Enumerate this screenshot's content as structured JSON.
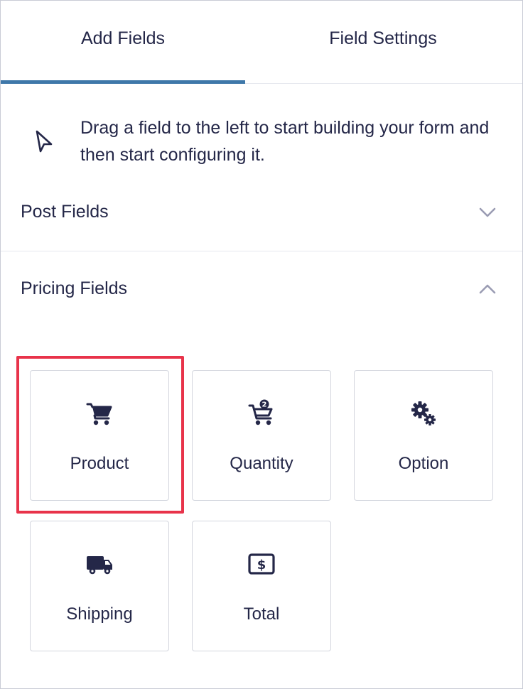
{
  "tabs": {
    "add_fields": "Add Fields",
    "field_settings": "Field Settings",
    "active": "add_fields"
  },
  "hint": {
    "text": "Drag a field to the left to start building your form and then start configuring it.",
    "icon": "cursor-arrow-icon"
  },
  "sections": {
    "post_fields": {
      "title": "Post Fields",
      "expanded": false,
      "icon": "chevron-down-icon"
    },
    "pricing_fields": {
      "title": "Pricing Fields",
      "expanded": true,
      "icon": "chevron-up-icon",
      "fields": [
        {
          "label": "Product",
          "icon": "shopping-cart-icon",
          "highlighted": true
        },
        {
          "label": "Quantity",
          "icon": "cart-quantity-icon"
        },
        {
          "label": "Option",
          "icon": "gears-icon"
        },
        {
          "label": "Shipping",
          "icon": "truck-icon"
        },
        {
          "label": "Total",
          "icon": "dollar-bill-icon"
        }
      ]
    }
  },
  "colors": {
    "accent": "#3f78a9",
    "text": "#242748",
    "highlight": "#e8334a",
    "chevron": "#9a9cb3",
    "border": "#d3d6de"
  }
}
